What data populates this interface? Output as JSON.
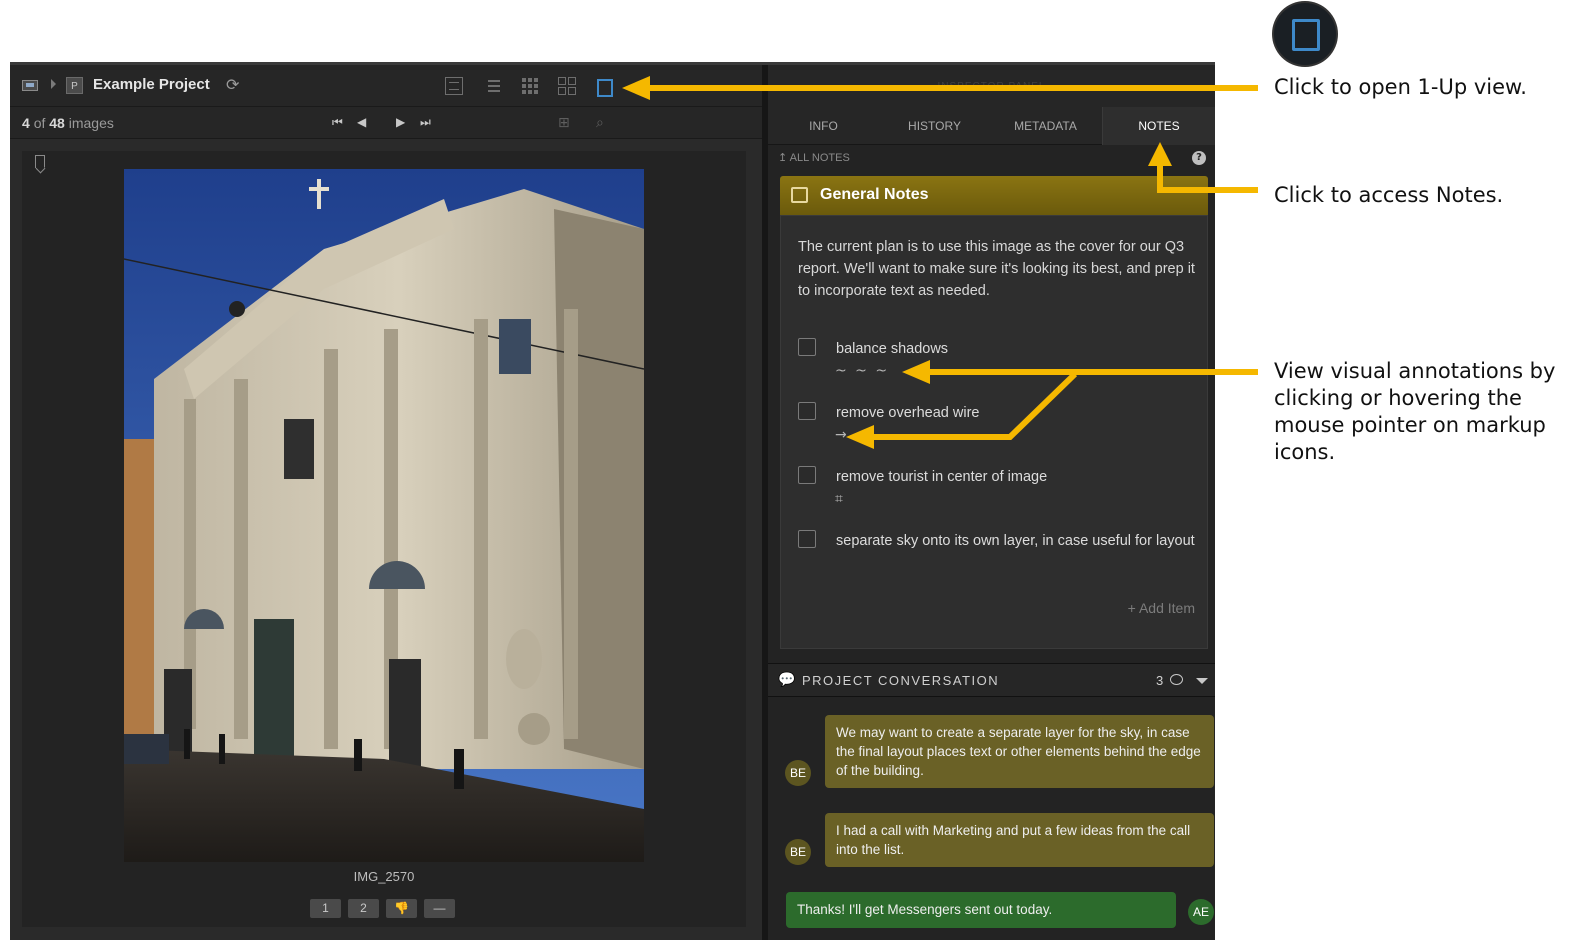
{
  "header": {
    "project_badge": "P",
    "project_name": "Example Project"
  },
  "subbar": {
    "current": "4",
    "of": "of",
    "total": "48",
    "unit": "images"
  },
  "viewer": {
    "image_name": "IMG_2570",
    "rating_buttons": [
      "1",
      "2",
      "👎",
      "—"
    ]
  },
  "inspector": {
    "title": "INSPECTOR PANEL",
    "tabs": [
      "INFO",
      "HISTORY",
      "METADATA",
      "NOTES"
    ],
    "active_tab": "NOTES",
    "all_notes": "ALL NOTES",
    "help": "?"
  },
  "notes": {
    "title": "General Notes",
    "body": "The current plan is to use this image as the cover for our Q3 report. We'll want to make sure it's looking its best, and prep it to incorporate text as needed.",
    "items": [
      {
        "label": "balance shadows",
        "markup": "~ ~ ~",
        "markup_icon": "brush-strokes-icon"
      },
      {
        "label": "remove overhead wire",
        "markup": "→",
        "markup_icon": "arrow-icon"
      },
      {
        "label": "remove tourist in center of image",
        "markup": "⌗",
        "markup_icon": "selection-box-icon"
      },
      {
        "label": "separate sky onto its own layer, in case useful for layout",
        "markup": "",
        "markup_icon": ""
      }
    ],
    "add_item": "+ Add Item"
  },
  "conversation": {
    "title": "PROJECT CONVERSATION",
    "count": "3",
    "messages": [
      {
        "author": "BE",
        "text": "We may want to create a separate layer for the sky, in case the final layout places text or other elements behind the edge of the building.",
        "side": "left"
      },
      {
        "author": "BE",
        "text": "I had a call with Marketing and put a few ideas from the call into the list.",
        "side": "left"
      },
      {
        "author": "AE",
        "text": "Thanks! I'll get Messengers sent out today.",
        "side": "right"
      }
    ]
  },
  "callouts": {
    "oneup": "Click to open 1-Up view.",
    "notes": "Click to access Notes.",
    "annotations": "View visual annotations by clicking or hovering the mouse pointer on markup icons."
  },
  "colors": {
    "accent": "#3e89c9",
    "notes_gold": "#8a7412",
    "arrow_yellow": "#f5b800",
    "msg_olive": "#6a6126",
    "msg_green": "#2c6b2c"
  }
}
